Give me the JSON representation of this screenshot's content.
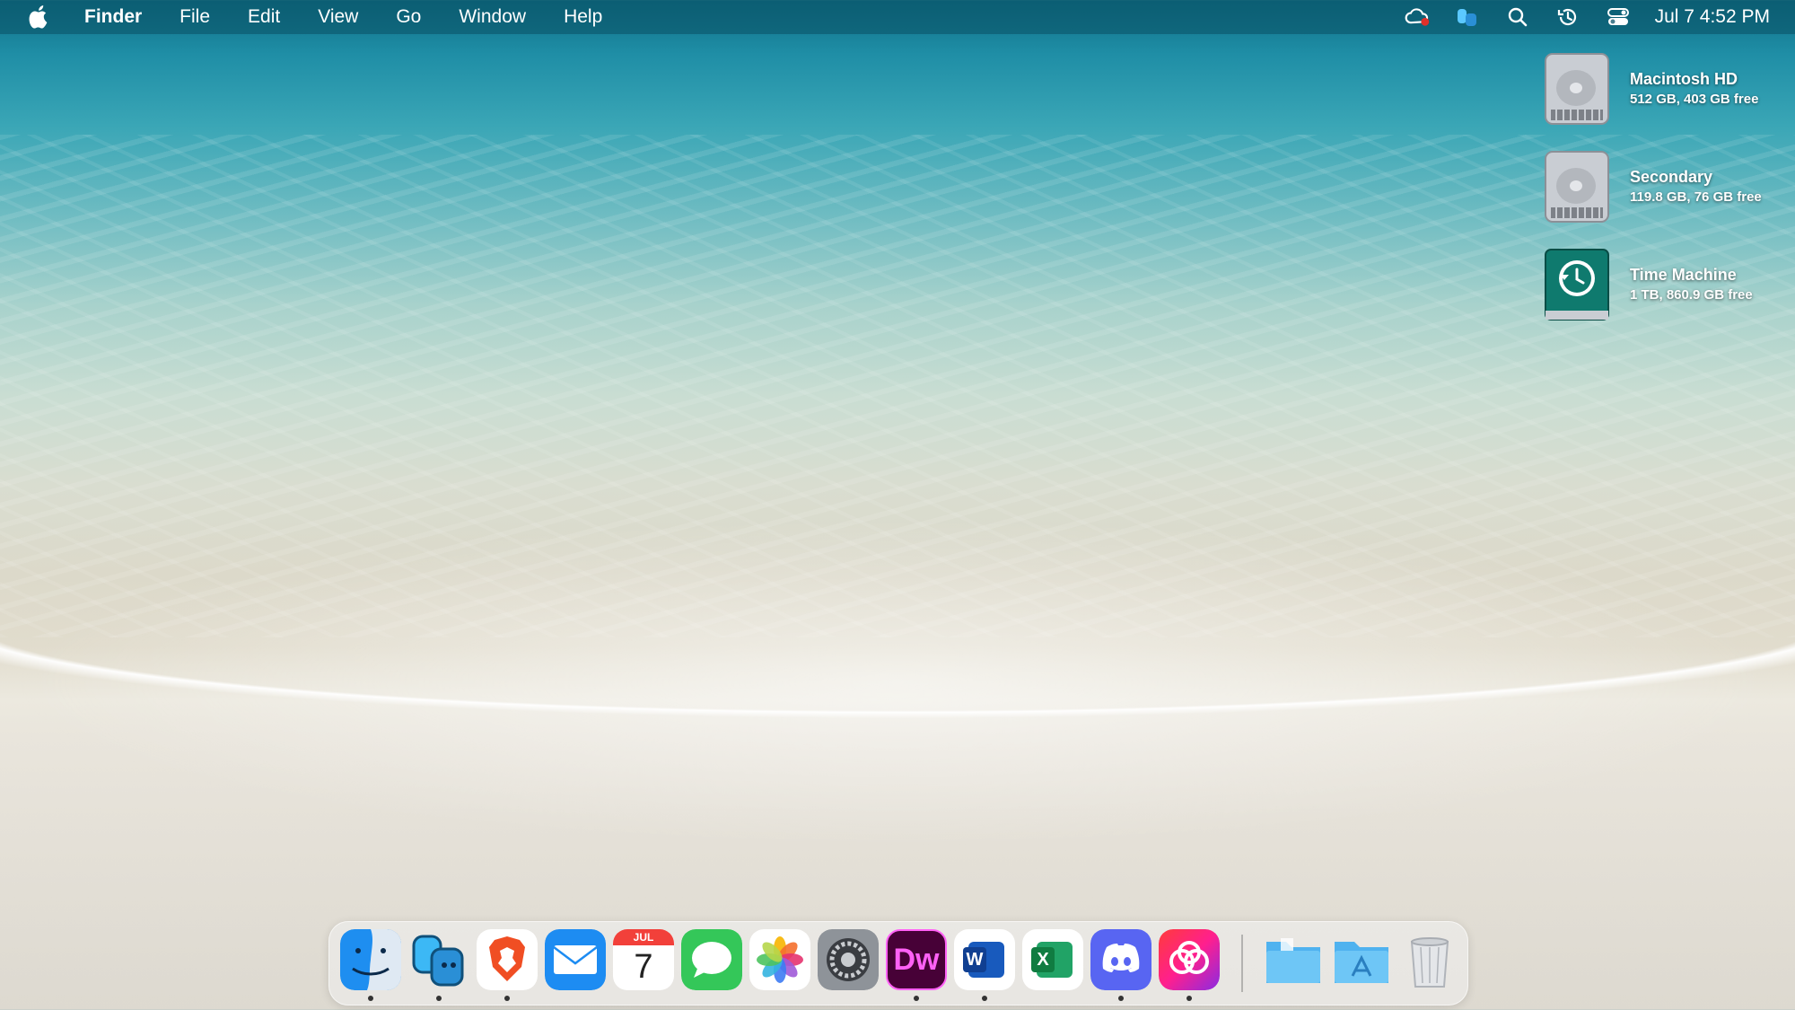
{
  "menubar": {
    "app_name": "Finder",
    "menus": [
      "File",
      "Edit",
      "View",
      "Go",
      "Window",
      "Help"
    ],
    "status_icons": [
      "creative-cloud-icon",
      "finder-app-icon",
      "search-icon",
      "time-machine-icon",
      "control-center-icon"
    ],
    "clock": "Jul 7  4:52 PM"
  },
  "desktop": {
    "disks": [
      {
        "name": "Macintosh HD",
        "info": "512 GB, 403 GB free",
        "icon": "hard-drive-icon"
      },
      {
        "name": "Secondary",
        "info": "119.8 GB, 76 GB free",
        "icon": "hard-drive-icon"
      },
      {
        "name": "Time Machine",
        "info": "1 TB, 860.9 GB free",
        "icon": "time-machine-drive-icon"
      }
    ]
  },
  "dock": {
    "apps": [
      {
        "name": "Finder",
        "running": true
      },
      {
        "name": "App (blue hands)",
        "running": true
      },
      {
        "name": "Brave",
        "running": true
      },
      {
        "name": "Mail",
        "running": false
      },
      {
        "name": "Calendar",
        "running": false,
        "month": "JUL",
        "day": "7"
      },
      {
        "name": "Messages",
        "running": false
      },
      {
        "name": "Photos",
        "running": false
      },
      {
        "name": "System Preferences",
        "running": false
      },
      {
        "name": "Dreamweaver",
        "running": true,
        "label": "Dw"
      },
      {
        "name": "Microsoft Word",
        "running": true,
        "label": "W"
      },
      {
        "name": "Microsoft Excel",
        "running": false,
        "label": "X"
      },
      {
        "name": "Discord",
        "running": true
      },
      {
        "name": "Creative Cloud",
        "running": true
      }
    ],
    "folders": [
      "Documents folder",
      "Applications folder",
      "Trash"
    ]
  }
}
